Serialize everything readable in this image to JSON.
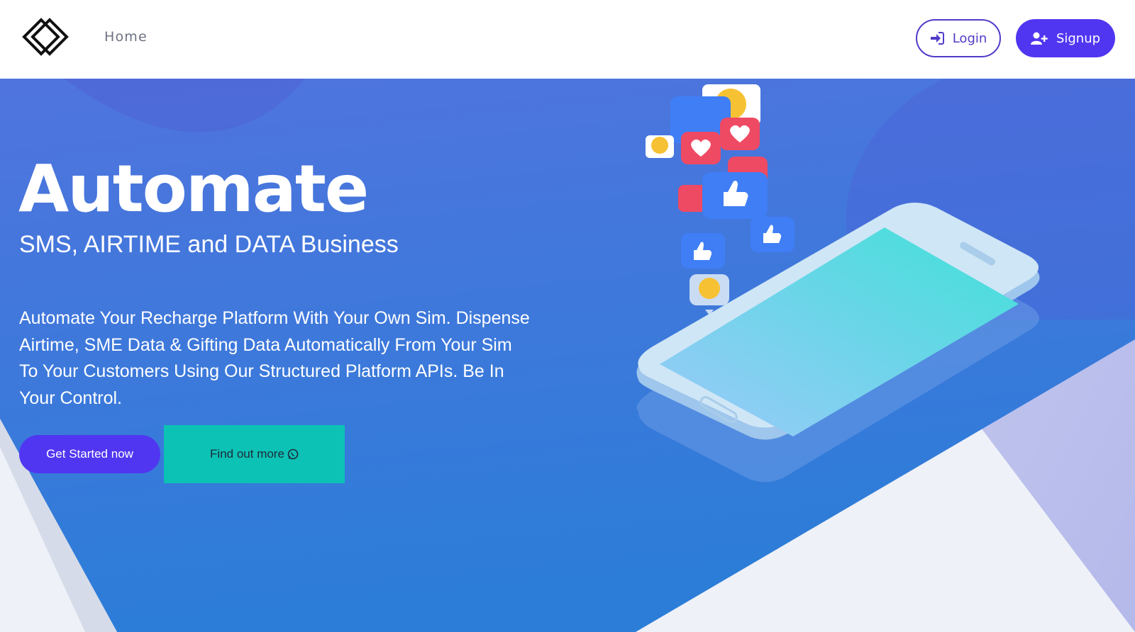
{
  "nav": {
    "home_label": "Home",
    "login_label": "Login",
    "signup_label": "Signup",
    "icons": {
      "logo": "diamond-logo-icon",
      "login": "sign-in-icon",
      "signup": "user-plus-icon"
    }
  },
  "hero": {
    "title": "Automate",
    "subtitle": "SMS, AIRTIME and DATA Business",
    "description": "Automate Your Recharge Platform With Your Own Sim. Dispense Airtime, SME Data & Gifting Data Automatically From Your Sim To Your Customers Using Our Structured Platform APIs. Be In Your Control.",
    "cta_primary": "Get Started now",
    "cta_secondary": "Find out more",
    "cta_secondary_icon": "whatsapp-icon"
  },
  "colors": {
    "brand_purple": "#5136f1",
    "teal": "#0cc2b5",
    "hero_blue_top": "#4f6fdc",
    "hero_blue_bottom": "#2b7fd8",
    "reaction_red": "#ef4a63",
    "reaction_blue": "#3f7ef5"
  }
}
